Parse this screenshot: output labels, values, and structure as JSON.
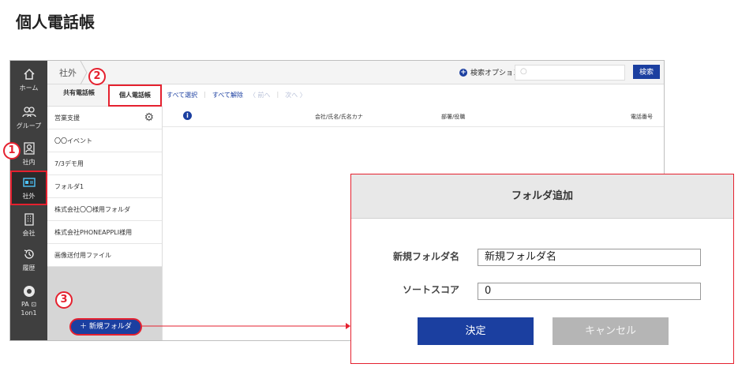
{
  "page_title": "個人電話帳",
  "sidebar": {
    "items": [
      {
        "icon": "home-icon",
        "label": "ホーム"
      },
      {
        "icon": "group-icon",
        "label": "グループ"
      },
      {
        "icon": "contacts-icon",
        "label": "社内"
      },
      {
        "icon": "external-card-icon",
        "label": "社外",
        "active": true
      },
      {
        "icon": "building-icon",
        "label": "会社"
      },
      {
        "icon": "history-icon",
        "label": "履歴"
      },
      {
        "icon": "pa-icon",
        "label": "PA ⊡\n1on1"
      }
    ]
  },
  "topbar": {
    "breadcrumb": "社外",
    "search_option_label": "検索オプション",
    "search_placeholder": "",
    "search_button": "検索"
  },
  "tabs": {
    "shared": "共有電話帳",
    "personal": "個人電話帳"
  },
  "actions": {
    "select_all": "すべて選択",
    "deselect_all": "すべて解除",
    "prev": "〈 前へ",
    "next": "次へ 〉"
  },
  "folders": [
    "営業支援",
    "〇〇イベント",
    "7/3デモ用",
    "フォルダ1",
    "株式会社〇〇様用フォルダ",
    "株式会社PHONEAPPLI様用",
    "画像送付用ファイル"
  ],
  "new_folder_button": "＋ 新規フォルダ",
  "columns": {
    "company": "会社/氏名/氏名カナ",
    "dept": "部署/役職",
    "phone": "電話番号"
  },
  "annotations": {
    "one": "1",
    "two": "2",
    "three": "3"
  },
  "dialog": {
    "title": "フォルダ追加",
    "name_label": "新規フォルダ名",
    "name_value": "新規フォルダ名",
    "sort_label": "ソートスコア",
    "sort_value": "0",
    "ok_button": "決定",
    "cancel_button": "キャンセル"
  },
  "colors": {
    "accent": "#1b3fa0",
    "highlight": "#e5212f",
    "rail": "#3f3f3f"
  }
}
